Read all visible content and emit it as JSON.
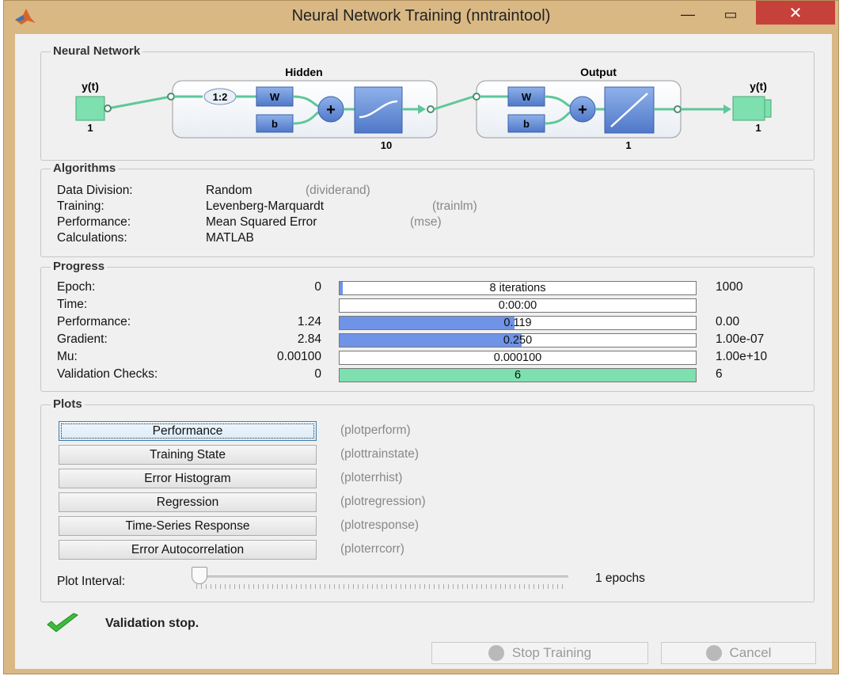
{
  "window": {
    "title": "Neural Network Training (nntraintool)",
    "minimize": "—",
    "maximize": "▭",
    "close": "✕"
  },
  "network": {
    "legend": "Neural Network",
    "input_label": "y(t)",
    "input_size": "1",
    "hidden_title": "Hidden",
    "delay_label": "1:2",
    "w_label": "W",
    "b_label": "b",
    "hidden_size": "10",
    "output_title": "Output",
    "output_w_label": "W",
    "output_b_label": "b",
    "output_size": "1",
    "output_label": "y(t)",
    "output_node_size": "1",
    "plus": "+"
  },
  "algorithms": {
    "legend": "Algorithms",
    "rows": [
      {
        "name": "Data Division:",
        "value": "Random",
        "fn": "(dividerand)"
      },
      {
        "name": "Training:",
        "value": "Levenberg-Marquardt",
        "fn": "(trainlm)"
      },
      {
        "name": "Performance:",
        "value": "Mean Squared Error",
        "fn": "(mse)"
      },
      {
        "name": "Calculations:",
        "value": "MATLAB",
        "fn": ""
      }
    ]
  },
  "progress": {
    "legend": "Progress",
    "rows": [
      {
        "name": "Epoch:",
        "start": "0",
        "current": "8 iterations",
        "end": "1000",
        "fill": 0.008,
        "color": "#6f93e6"
      },
      {
        "name": "Time:",
        "start": "",
        "current": "0:00:00",
        "end": "",
        "fill": 0,
        "color": "#6f93e6"
      },
      {
        "name": "Performance:",
        "start": "1.24",
        "current": "0.119",
        "end": "0.00",
        "fill": 0.49,
        "color": "#6f93e6"
      },
      {
        "name": "Gradient:",
        "start": "2.84",
        "current": "0.250",
        "end": "1.00e-07",
        "fill": 0.51,
        "color": "#6f93e6"
      },
      {
        "name": "Mu:",
        "start": "0.00100",
        "current": "0.000100",
        "end": "1.00e+10",
        "fill": 0,
        "color": "#6f93e6"
      },
      {
        "name": "Validation Checks:",
        "start": "0",
        "current": "6",
        "end": "6",
        "fill": 1.0,
        "color": "#7de0ae"
      }
    ]
  },
  "plots": {
    "legend": "Plots",
    "buttons": [
      {
        "label": "Performance",
        "fn": "(plotperform)"
      },
      {
        "label": "Training State",
        "fn": "(plottrainstate)"
      },
      {
        "label": "Error Histogram",
        "fn": "(ploterrhist)"
      },
      {
        "label": "Regression",
        "fn": "(plotregression)"
      },
      {
        "label": "Time-Series Response",
        "fn": "(plotresponse)"
      },
      {
        "label": "Error Autocorrelation",
        "fn": "(ploterrcorr)"
      }
    ],
    "interval_label": "Plot Interval:",
    "interval_value": "1 epochs"
  },
  "status": {
    "icon": "checkmark-icon",
    "text": "Validation stop."
  },
  "footer": {
    "stop_label": "Stop Training",
    "cancel_label": "Cancel"
  }
}
